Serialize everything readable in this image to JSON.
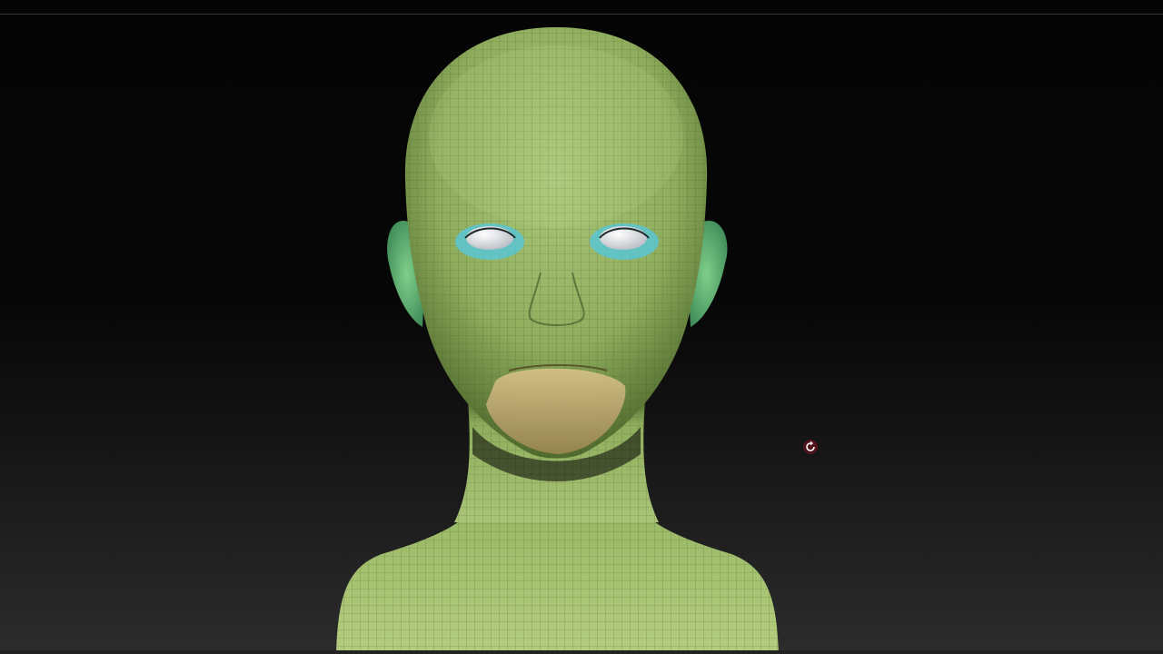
{
  "viewport": {
    "background_top": "#050505",
    "background_bottom": "#2c2c2c"
  },
  "model": {
    "skin_color": "#9dbb6b",
    "lip_mask_color": "#c9b278",
    "eye_outline_color": "#5bc6d3",
    "eyeball_color": "#e8e8ea",
    "wireframe_color": "#3b4a22"
  },
  "cursor": {
    "icon": "rotate-cursor-icon",
    "color": "#ffffff",
    "outline": "#7a1420"
  }
}
